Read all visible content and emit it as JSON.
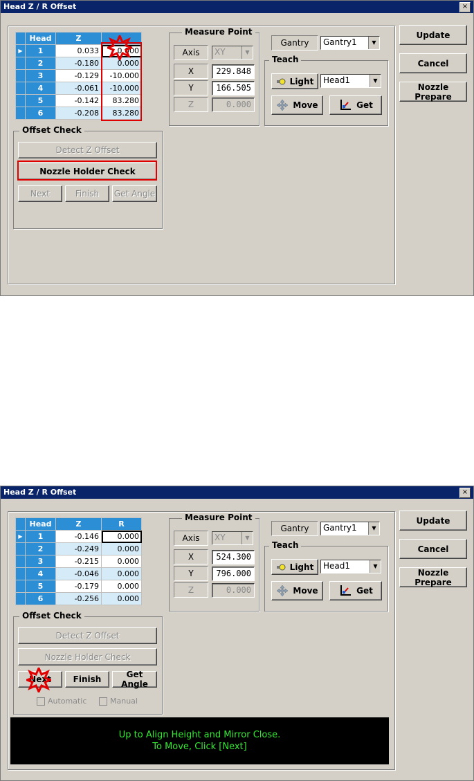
{
  "window1": {
    "title": "Head Z / R Offset",
    "close": "×",
    "grid": {
      "headers": [
        "Head",
        "Z",
        "R"
      ],
      "rows": [
        {
          "head": "1",
          "z": "0.033",
          "r": "0.000"
        },
        {
          "head": "2",
          "z": "-0.180",
          "r": "0.000"
        },
        {
          "head": "3",
          "z": "-0.129",
          "r": "-10.000"
        },
        {
          "head": "4",
          "z": "-0.061",
          "r": "-10.000"
        },
        {
          "head": "5",
          "z": "-0.142",
          "r": "83.280"
        },
        {
          "head": "6",
          "z": "-0.208",
          "r": "83.280"
        }
      ]
    },
    "measure": {
      "title": "Measure Point",
      "axis_label": "Axis",
      "axis_value": "XY",
      "x_label": "X",
      "x_value": "229.848",
      "y_label": "Y",
      "y_value": "166.505",
      "z_label": "Z",
      "z_value": "0.000"
    },
    "gantry": {
      "label": "Gantry",
      "value": "Gantry1"
    },
    "teach": {
      "title": "Teach",
      "light": "Light",
      "head": "Head1",
      "move": "Move",
      "get": "Get"
    },
    "offset": {
      "title": "Offset Check",
      "detect": "Detect Z Offset",
      "nozzle_check": "Nozzle Holder Check",
      "next": "Next",
      "finish": "Finish",
      "get_angle": "Get Angle"
    },
    "buttons": {
      "update": "Update",
      "cancel": "Cancel",
      "nozzle_prepare": "Nozzle Prepare"
    }
  },
  "window2": {
    "title": "Head Z / R Offset",
    "close": "×",
    "grid": {
      "headers": [
        "Head",
        "Z",
        "R"
      ],
      "rows": [
        {
          "head": "1",
          "z": "-0.146",
          "r": "0.000"
        },
        {
          "head": "2",
          "z": "-0.249",
          "r": "0.000"
        },
        {
          "head": "3",
          "z": "-0.215",
          "r": "0.000"
        },
        {
          "head": "4",
          "z": "-0.046",
          "r": "0.000"
        },
        {
          "head": "5",
          "z": "-0.179",
          "r": "0.000"
        },
        {
          "head": "6",
          "z": "-0.256",
          "r": "0.000"
        }
      ]
    },
    "measure": {
      "title": "Measure Point",
      "axis_label": "Axis",
      "axis_value": "XY",
      "x_label": "X",
      "x_value": "524.300",
      "y_label": "Y",
      "y_value": "796.000",
      "z_label": "Z",
      "z_value": "0.000"
    },
    "gantry": {
      "label": "Gantry",
      "value": "Gantry1"
    },
    "teach": {
      "title": "Teach",
      "light": "Light",
      "head": "Head1",
      "move": "Move",
      "get": "Get"
    },
    "offset": {
      "title": "Offset Check",
      "detect": "Detect Z Offset",
      "nozzle_check": "Nozzle Holder Check",
      "next": "Next",
      "finish": "Finish",
      "get_angle": "Get Angle",
      "automatic": "Automatic",
      "manual": "Manual"
    },
    "buttons": {
      "update": "Update",
      "cancel": "Cancel",
      "nozzle_prepare": "Nozzle Prepare"
    },
    "message": {
      "line1": "Up to Align Height and Mirror Close.",
      "line2": "To Move, Click [Next]"
    }
  },
  "colors": {
    "dialog_bg": "#d4d0c8",
    "grid_header": "#2c8fd6",
    "highlight": "#e00000",
    "message_text": "#34e834"
  },
  "icons": {
    "light": "lightbulb-icon",
    "move": "move-arrows-icon",
    "get": "get-axis-icon",
    "star": "red-star-marker-icon"
  }
}
